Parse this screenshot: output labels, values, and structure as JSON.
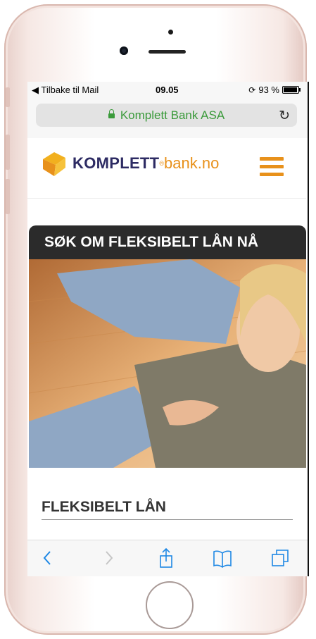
{
  "status_bar": {
    "back_to_app": "◀ Tilbake til Mail",
    "time": "09.05",
    "battery_percent": "93 %",
    "battery_level": 0.93
  },
  "browser": {
    "url_display": "Komplett Bank ASA",
    "secure_color": "#3a9a3a"
  },
  "site": {
    "logo_brand": "KOMPLETT",
    "logo_registered": "®",
    "logo_domain": "bank.no",
    "brand_color": "#2d2b63",
    "accent_color": "#e8911b"
  },
  "content": {
    "banner_title": "SØK OM FLEKSIBELT LÅN NÅ",
    "section_heading": "FLEKSIBELT LÅN"
  },
  "toolbar": {
    "icons": [
      "back-icon",
      "forward-icon",
      "share-icon",
      "bookmarks-icon",
      "tabs-icon"
    ]
  }
}
